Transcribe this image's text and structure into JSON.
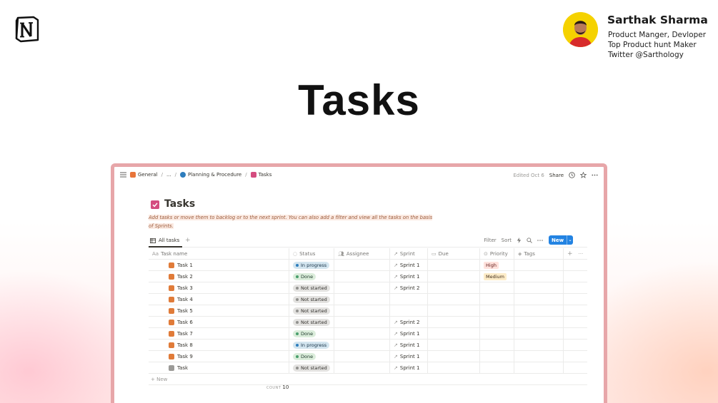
{
  "profile": {
    "name": "Sarthak Sharma",
    "lines": [
      "Product Manger, Devloper",
      "Top Product hunt Maker",
      "Twitter @Sarthology"
    ]
  },
  "hero_title": "Tasks",
  "window": {
    "breadcrumbs": [
      "General",
      "...",
      "Planning & Procedure",
      "Tasks"
    ],
    "edited": "Edited Oct 6",
    "share": "Share",
    "page_title": "Tasks",
    "description": "Add tasks or move them to backlog or to the next sprint. You can also add a filter and view all the tasks on the basis of Sprints.",
    "view_tab": "All tasks",
    "tools": {
      "filter": "Filter",
      "sort": "Sort",
      "new": "New"
    },
    "columns": {
      "name": "Task name",
      "status": "Status",
      "assignee": "Assignee",
      "sprint": "Sprint",
      "due": "Due",
      "priority": "Priority",
      "tags": "Tags"
    },
    "rows": [
      {
        "name": "Task 1",
        "icon_color": "#e07b39",
        "status": "In progress",
        "status_kind": "inprogress",
        "sprint": "Sprint 1",
        "priority": "High",
        "priority_kind": "high"
      },
      {
        "name": "Task 2",
        "icon_color": "#e07b39",
        "status": "Done",
        "status_kind": "done",
        "sprint": "Sprint 1",
        "priority": "Medium",
        "priority_kind": "medium"
      },
      {
        "name": "Task 3",
        "icon_color": "#e07b39",
        "status": "Not started",
        "status_kind": "notstarted",
        "sprint": "Sprint 2",
        "priority": "",
        "priority_kind": ""
      },
      {
        "name": "Task 4",
        "icon_color": "#e07b39",
        "status": "Not started",
        "status_kind": "notstarted",
        "sprint": "",
        "priority": "",
        "priority_kind": ""
      },
      {
        "name": "Task 5",
        "icon_color": "#e07b39",
        "status": "Not started",
        "status_kind": "notstarted",
        "sprint": "",
        "priority": "",
        "priority_kind": ""
      },
      {
        "name": "Task 6",
        "icon_color": "#e07b39",
        "status": "Not started",
        "status_kind": "notstarted",
        "sprint": "Sprint 2",
        "priority": "",
        "priority_kind": ""
      },
      {
        "name": "Task 7",
        "icon_color": "#e07b39",
        "status": "Done",
        "status_kind": "done",
        "sprint": "Sprint 1",
        "priority": "",
        "priority_kind": ""
      },
      {
        "name": "Task 8",
        "icon_color": "#e07b39",
        "status": "In progress",
        "status_kind": "inprogress",
        "sprint": "Sprint 1",
        "priority": "",
        "priority_kind": ""
      },
      {
        "name": "Task 9",
        "icon_color": "#e07b39",
        "status": "Done",
        "status_kind": "done",
        "sprint": "Sprint 1",
        "priority": "",
        "priority_kind": ""
      },
      {
        "name": "Task",
        "icon_color": "#9b9a97",
        "status": "Not started",
        "status_kind": "notstarted",
        "sprint": "Sprint 1",
        "priority": "",
        "priority_kind": ""
      }
    ],
    "add_new": "+ New",
    "count_label": "COUNT",
    "count_value": "10"
  }
}
